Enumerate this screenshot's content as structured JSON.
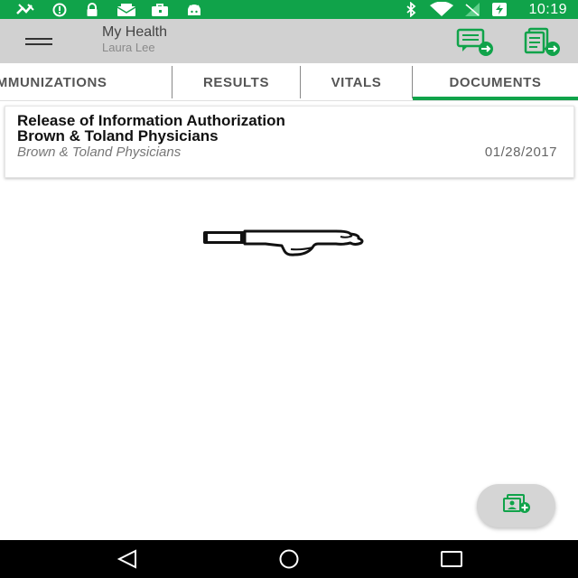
{
  "status_bar": {
    "time": "10:19",
    "left_icons": [
      "satellite-icon",
      "alert-circle-icon",
      "lock-icon",
      "mail-open-icon",
      "briefcase-icon",
      "android-icon"
    ],
    "right_icons": [
      "bluetooth-icon",
      "wifi-icon",
      "signal-icon",
      "battery-charging-icon"
    ],
    "color": "#10a34a"
  },
  "app_bar": {
    "title": "My Health",
    "subtitle": "Laura Lee",
    "actions": [
      "message-forward-icon",
      "document-forward-icon"
    ]
  },
  "tabs": [
    {
      "label": "IMMUNIZATIONS",
      "selected": false
    },
    {
      "label": "RESULTS",
      "selected": false
    },
    {
      "label": "VITALS",
      "selected": false
    },
    {
      "label": "DOCUMENTS",
      "selected": true
    }
  ],
  "documents": [
    {
      "title_line1": "Release of Information Authorization",
      "title_line2": "Brown & Toland Physicians",
      "provider": "Brown & Toland Physicians",
      "date": "01/28/2017"
    }
  ],
  "fab": {
    "icon": "add-document-icon"
  },
  "nav_bar": {
    "icons": [
      "back-icon",
      "home-icon",
      "recents-icon"
    ]
  },
  "accent_color": "#10a34a"
}
